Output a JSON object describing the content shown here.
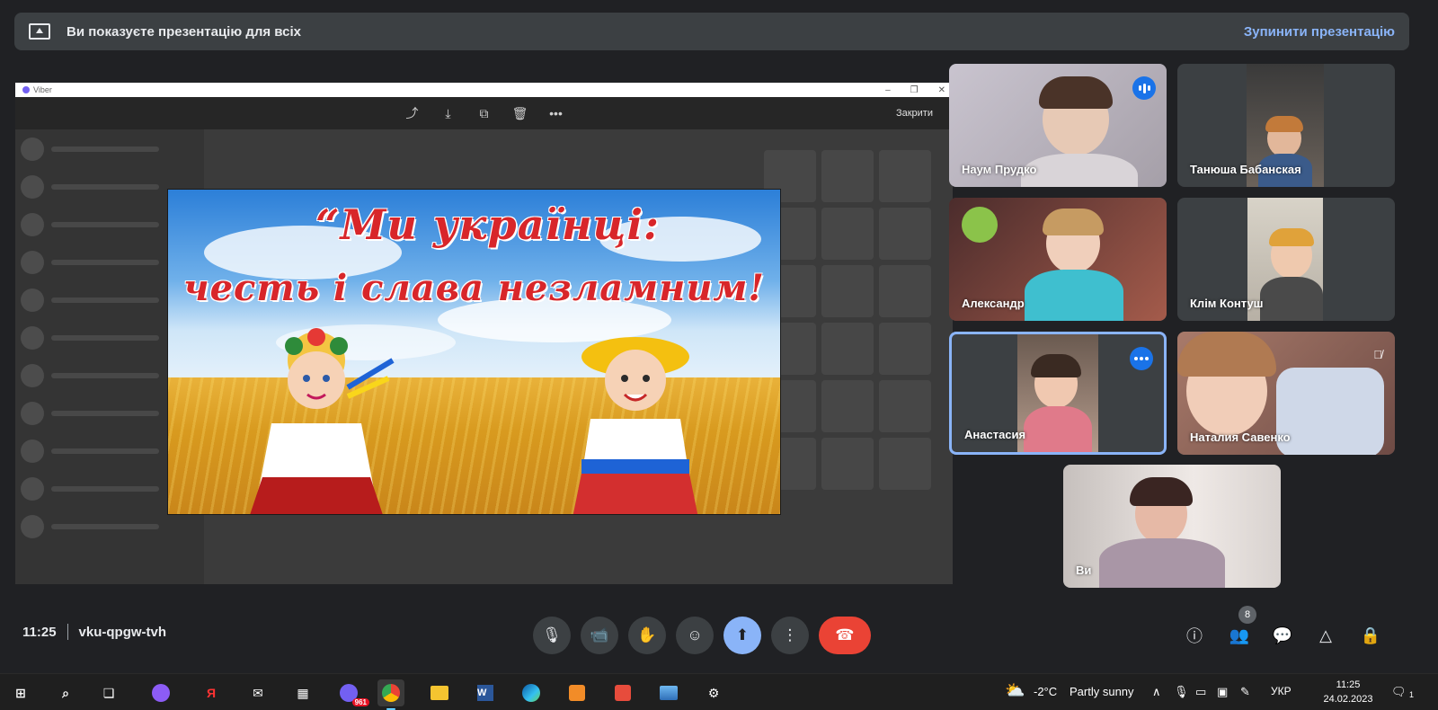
{
  "banner": {
    "text": "Ви показуєте презентацію для всіх",
    "stop_label": "Зупинити презентацію"
  },
  "viewer": {
    "app_title": "Viber",
    "close_label": "Закрити",
    "toolbar_icons": [
      "share-icon",
      "download-icon",
      "forward-icon",
      "trash-icon",
      "more-horizontal-icon"
    ]
  },
  "slide": {
    "line1": "“Ми українці:",
    "line2": "честь і слава незламним!"
  },
  "participants": [
    {
      "name": "Наум Прудко",
      "speaking": true
    },
    {
      "name": "Танюша Бабанская"
    },
    {
      "name": "Александр"
    },
    {
      "name": "Клім Контуш"
    },
    {
      "name": "Анастасия",
      "pinned": true
    },
    {
      "name": "Наталия Савенко",
      "muted": true
    },
    {
      "name": "Ви"
    }
  ],
  "meeting": {
    "time": "11:25",
    "code": "vku-qpgw-tvh",
    "people_count": "8"
  },
  "colors": {
    "accent": "#8ab4f8",
    "end_call": "#ea4335",
    "badge": "#1a73e8"
  },
  "taskbar": {
    "viber_badge": "961",
    "weather_temp": "-2°C",
    "weather_desc": "Partly sunny",
    "language": "УКР",
    "time": "11:25",
    "date": "24.02.2023",
    "notifications": "1"
  }
}
